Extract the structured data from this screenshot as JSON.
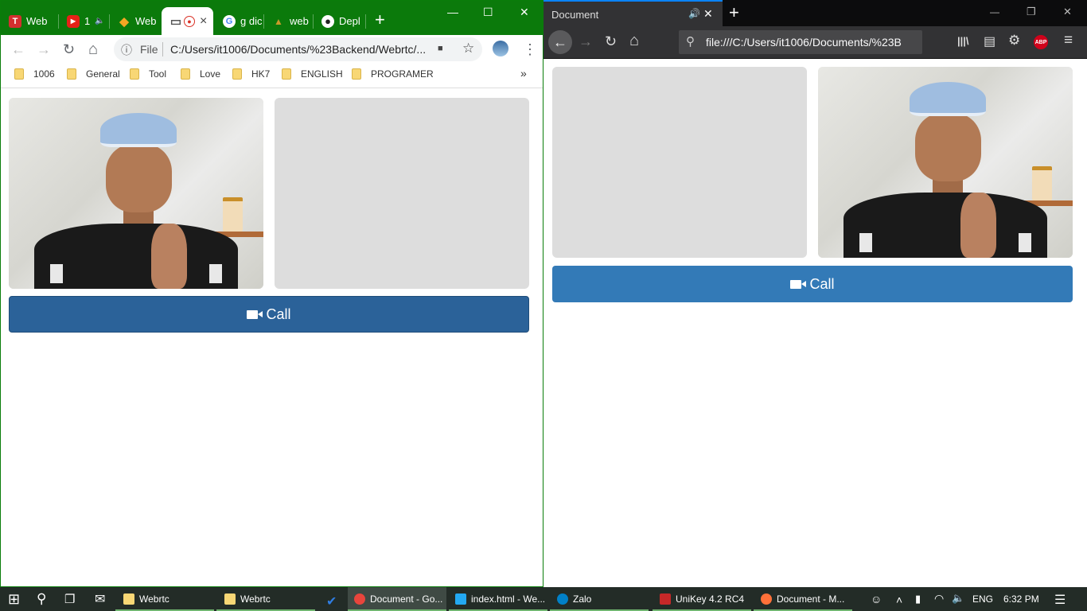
{
  "chrome": {
    "tabs": [
      {
        "title": "Web",
        "favicon": "T",
        "favicon_color": "#d32f2f"
      },
      {
        "title": "1",
        "favicon": "▶",
        "favicon_color": "#e62117",
        "audio": "🔈"
      },
      {
        "title": "Web",
        "favicon": "◆",
        "favicon_color": "#f5a623"
      },
      {
        "title": "",
        "favicon": "▭",
        "favicon_color": "#ffffff",
        "active": true,
        "recording": "●",
        "close": "×"
      },
      {
        "title": "g dic",
        "favicon": "G",
        "favicon_color": "#4285f4"
      },
      {
        "title": "web",
        "favicon": "▲",
        "favicon_color": "#c79a2a"
      },
      {
        "title": "Depl",
        "favicon": "●",
        "favicon_color": "#222222"
      }
    ],
    "new_tab": "+",
    "window_controls": {
      "minimize": "—",
      "maximize": "☐",
      "close": "✕"
    },
    "nav": {
      "back": "←",
      "forward": "→",
      "reload": "↻",
      "home": "⌂"
    },
    "omnibox": {
      "info": "ⓘ",
      "scheme": "File",
      "url": "C:/Users/it1006/Documents/%23Backend/Webrtc/...",
      "camera": "■",
      "star": "☆"
    },
    "menu": "⋮",
    "bookmarks": [
      "1006",
      "General",
      "Tool",
      "Love",
      "HK7",
      "ENGLISH",
      "PROGRAMER"
    ],
    "bookmarks_more": "»",
    "call_label": "Call",
    "call_color": "#2b6299"
  },
  "firefox": {
    "tab_title": "Document",
    "tab_audio": "🔊",
    "tab_close": "✕",
    "new_tab": "+",
    "window_controls": {
      "minimize": "—",
      "maximize": "❐",
      "close": "✕"
    },
    "nav": {
      "back": "←",
      "forward": "→",
      "reload": "↻",
      "home": "⌂"
    },
    "search_icon": "⚲",
    "url": "file:///C:/Users/it1006/Documents/%23B",
    "toolbar_icons": {
      "library": "|||\\",
      "sidebar": "▤",
      "settings": "⚙",
      "abp": "ABP",
      "menu": "≡"
    },
    "call_label": "Call",
    "call_color": "#337ab7"
  },
  "taskbar": {
    "start": "⊞",
    "search": "⚲",
    "taskview": "❐",
    "mail": "✉",
    "items": [
      {
        "label": "Webrtc",
        "icon_color": "#f8d775"
      },
      {
        "label": "Webrtc",
        "icon_color": "#f8d775"
      },
      {
        "label": "",
        "icon_color": "#2f7de1"
      },
      {
        "label": "Document - Go...",
        "icon_color": "#e8453c",
        "active": true
      },
      {
        "label": "index.html - We...",
        "icon_color": "#23a9f2"
      },
      {
        "label": "Zalo",
        "icon_color": "#0180c7"
      },
      {
        "label": "UniKey 4.2 RC4",
        "icon_color": "#c62828"
      },
      {
        "label": "Document - M...",
        "icon_color": "#ff7139"
      }
    ],
    "tray": {
      "people": "☺",
      "chevron": "˄",
      "battery": "▮",
      "wifi": "◠",
      "volume": "🔈",
      "lang": "ENG",
      "time": "6:32 PM",
      "notifications": "☰"
    }
  }
}
